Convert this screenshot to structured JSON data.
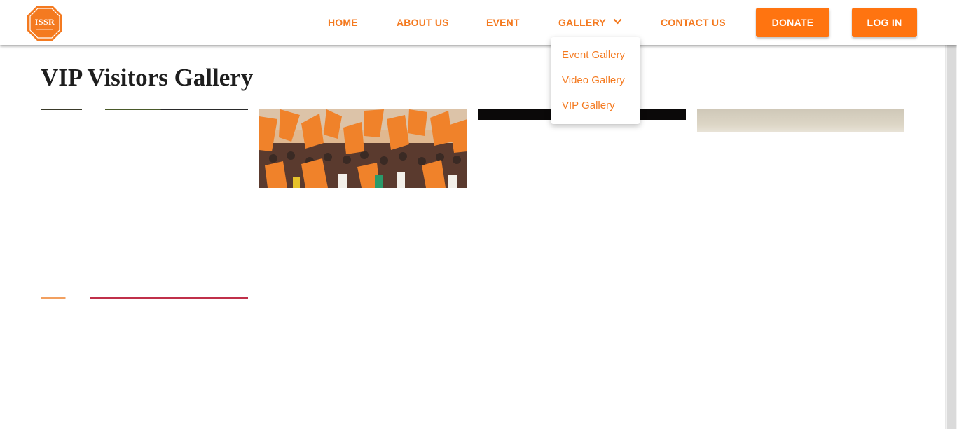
{
  "brand": {
    "logo_text": "ISSR",
    "accent": "#f47a20",
    "button_bg": "#ff7410"
  },
  "nav": {
    "home": "HOME",
    "about": "ABOUT US",
    "event": "EVENT",
    "gallery": "GALLERY",
    "contact": "CONTACT US",
    "donate": "DONATE",
    "login": "LOG IN"
  },
  "gallery_menu": {
    "items": [
      "Event Gallery",
      "Video Gallery",
      "VIP Gallery"
    ]
  },
  "page": {
    "title": "VIP Visitors Gallery"
  },
  "icons": {
    "dropdown": "chevron-down-icon",
    "logo": "octagon-logo-icon"
  }
}
